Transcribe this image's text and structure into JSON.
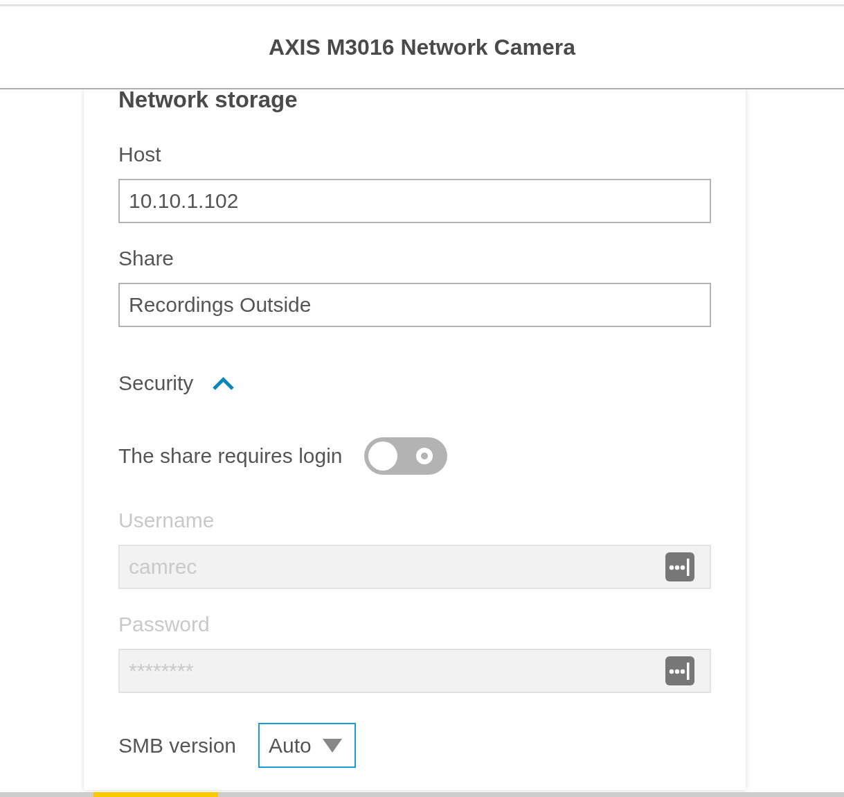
{
  "header": {
    "title": "AXIS M3016 Network Camera"
  },
  "section": {
    "title": "Network storage"
  },
  "fields": [
    {
      "label": "Host",
      "value": "10.10.1.102"
    },
    {
      "label": "Share",
      "value": "Recordings Outside"
    }
  ],
  "security": {
    "label": "Security",
    "expanded": true
  },
  "login_toggle": {
    "label": "The share requires login",
    "on": false
  },
  "credentials": [
    {
      "label": "Username",
      "value": "camrec",
      "disabled": true
    },
    {
      "label": "Password",
      "value": "********",
      "disabled": true
    }
  ],
  "smb_version": {
    "label": "SMB version",
    "value": "Auto"
  }
}
